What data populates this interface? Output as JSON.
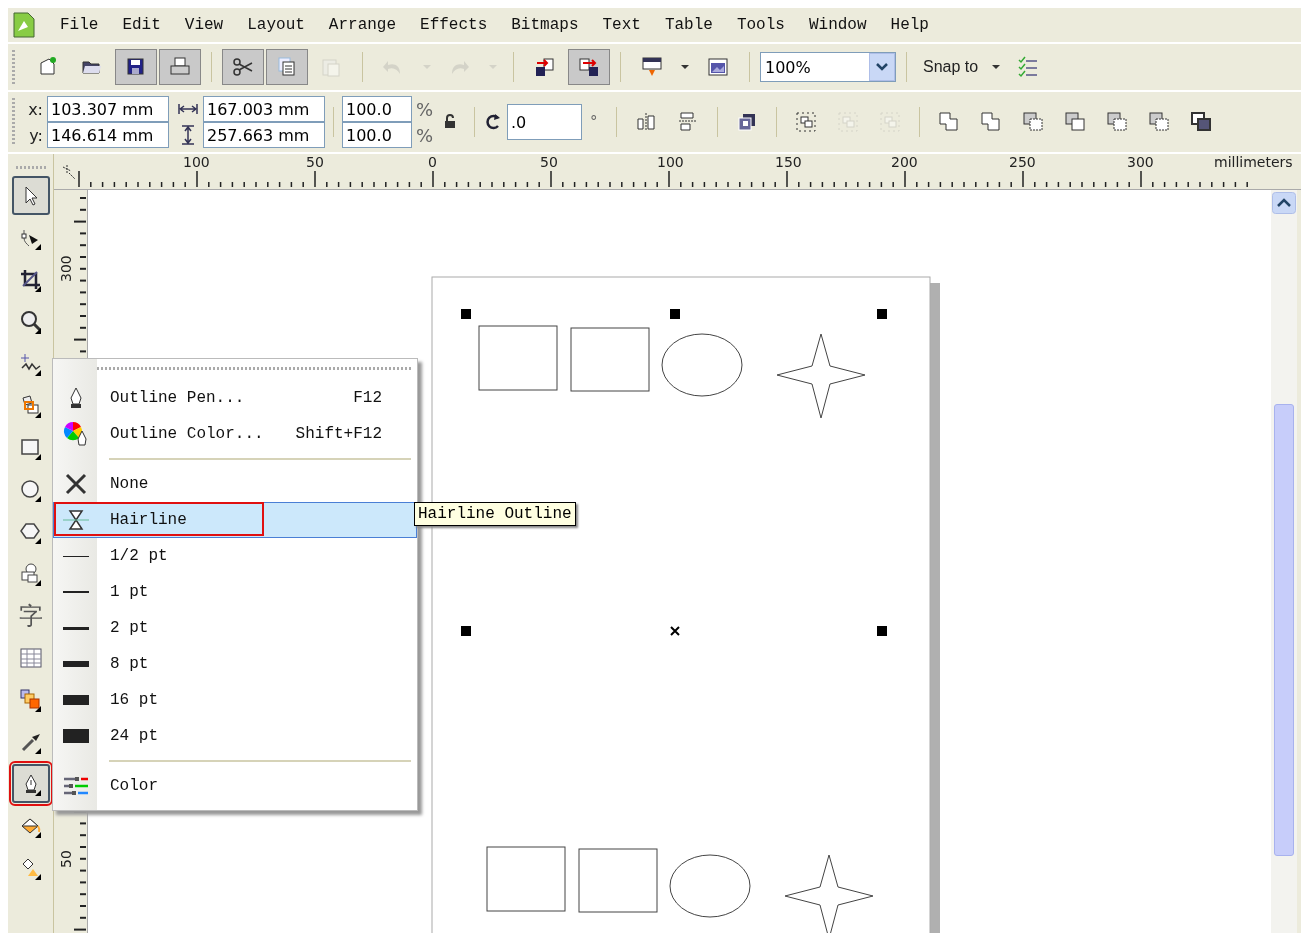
{
  "menu_bar": {
    "items": [
      "File",
      "Edit",
      "View",
      "Layout",
      "Arrange",
      "Effects",
      "Bitmaps",
      "Text",
      "Table",
      "Tools",
      "Window",
      "Help"
    ]
  },
  "toolbar": {
    "groups": [
      [
        {
          "kind": "new",
          "pressed": false,
          "disabled": false
        },
        {
          "kind": "open",
          "pressed": false,
          "disabled": false
        },
        {
          "kind": "save",
          "pressed": true,
          "disabled": false
        },
        {
          "kind": "print",
          "pressed": true,
          "disabled": false
        }
      ],
      [
        {
          "kind": "cut",
          "pressed": true,
          "disabled": false
        },
        {
          "kind": "copy",
          "pressed": true,
          "disabled": false
        },
        {
          "kind": "paste",
          "pressed": false,
          "disabled": true
        }
      ],
      [
        {
          "kind": "undo",
          "pressed": false,
          "disabled": true
        },
        {
          "kind": "dropdown",
          "pressed": false,
          "disabled": true
        },
        {
          "kind": "redo",
          "pressed": false,
          "disabled": true
        },
        {
          "kind": "dropdown",
          "pressed": false,
          "disabled": true
        }
      ],
      [
        {
          "kind": "import",
          "pressed": false,
          "disabled": false
        },
        {
          "kind": "export",
          "pressed": true,
          "disabled": false
        }
      ],
      [
        {
          "kind": "launcher",
          "pressed": false,
          "disabled": false
        },
        {
          "kind": "dropdown",
          "pressed": false,
          "disabled": false
        },
        {
          "kind": "welcome",
          "pressed": false,
          "disabled": false
        }
      ]
    ],
    "zoom": {
      "value": "100%"
    },
    "snap": {
      "label": "Snap to"
    }
  },
  "property_bar": {
    "x": {
      "label": "x:",
      "value": "103.307 mm"
    },
    "y": {
      "label": "y:",
      "value": "146.614 mm"
    },
    "width": {
      "value": "167.003 mm"
    },
    "height": {
      "value": "257.663 mm"
    },
    "scale_x": {
      "value": "100.0",
      "unit": "%"
    },
    "scale_y": {
      "value": "100.0",
      "unit": "%"
    },
    "rotation": {
      "value": ".0",
      "unit": "°"
    },
    "groups": [
      [
        {
          "kind": "mirror-h",
          "disabled": false
        },
        {
          "kind": "mirror-v",
          "disabled": false
        }
      ],
      [
        {
          "kind": "convert",
          "disabled": false
        }
      ],
      [
        {
          "kind": "group",
          "disabled": false
        },
        {
          "kind": "ungroup",
          "disabled": true
        },
        {
          "kind": "ungroup-all",
          "disabled": true
        }
      ],
      [
        {
          "kind": "weld",
          "disabled": false
        },
        {
          "kind": "trim",
          "disabled": false
        },
        {
          "kind": "intersect",
          "disabled": false
        },
        {
          "kind": "simplify",
          "disabled": false
        },
        {
          "kind": "front-minus",
          "disabled": false
        },
        {
          "kind": "back-minus",
          "disabled": false
        },
        {
          "kind": "boundary",
          "disabled": false
        }
      ]
    ]
  },
  "rulers": {
    "horizontal": [
      "100",
      "50",
      "0",
      "50",
      "100",
      "150",
      "200",
      "250",
      "300",
      "millimeters"
    ],
    "vertical": [
      "300",
      "50"
    ]
  },
  "toolbox": {
    "tools": [
      {
        "kind": "pick",
        "selected": true,
        "annotated": false
      },
      {
        "kind": "shape",
        "selected": false,
        "annotated": false
      },
      {
        "kind": "crop",
        "selected": false,
        "annotated": false
      },
      {
        "kind": "zoom",
        "selected": false,
        "annotated": false
      },
      {
        "kind": "freehand",
        "selected": false,
        "annotated": false
      },
      {
        "kind": "smart-fill",
        "selected": false,
        "annotated": false
      },
      {
        "kind": "rectangle",
        "selected": false,
        "annotated": false
      },
      {
        "kind": "ellipse",
        "selected": false,
        "annotated": false
      },
      {
        "kind": "polygon",
        "selected": false,
        "annotated": false
      },
      {
        "kind": "basic-shapes",
        "selected": false,
        "annotated": false
      },
      {
        "kind": "text",
        "glyph": "字",
        "selected": false,
        "annotated": false
      },
      {
        "kind": "table",
        "selected": false,
        "annotated": false
      },
      {
        "kind": "blend",
        "selected": false,
        "annotated": false
      },
      {
        "kind": "eyedropper",
        "selected": false,
        "annotated": false
      },
      {
        "kind": "outline",
        "selected": true,
        "annotated": true
      },
      {
        "kind": "fill",
        "selected": false,
        "annotated": false
      },
      {
        "kind": "interactive-fill",
        "selected": false,
        "annotated": false
      }
    ]
  },
  "outline_flyout": {
    "items": [
      {
        "kind": "pen",
        "label": "Outline Pen...",
        "shortcut": "F12",
        "selected": false,
        "annotated": false
      },
      {
        "kind": "color-wheel",
        "label": "Outline Color...",
        "shortcut": "Shift+F12",
        "selected": false,
        "annotated": false
      },
      {
        "kind": "separator"
      },
      {
        "kind": "none",
        "label": "None",
        "selected": false,
        "annotated": false
      },
      {
        "kind": "hairline",
        "label": "Hairline",
        "selected": true,
        "annotated": true
      },
      {
        "kind": "width",
        "label": "1/2 pt",
        "selected": false,
        "annotated": false
      },
      {
        "kind": "width",
        "label": "1 pt",
        "selected": false,
        "annotated": false
      },
      {
        "kind": "width",
        "label": "2 pt",
        "selected": false,
        "annotated": false
      },
      {
        "kind": "width",
        "label": "8 pt",
        "selected": false,
        "annotated": false
      },
      {
        "kind": "width",
        "label": "16 pt",
        "selected": false,
        "annotated": false
      },
      {
        "kind": "width",
        "label": "24 pt",
        "selected": false,
        "annotated": false
      },
      {
        "kind": "separator"
      },
      {
        "kind": "color-docker",
        "label": "Color",
        "selected": false,
        "annotated": false
      }
    ]
  },
  "tooltip": {
    "text": "Hairline Outline"
  }
}
